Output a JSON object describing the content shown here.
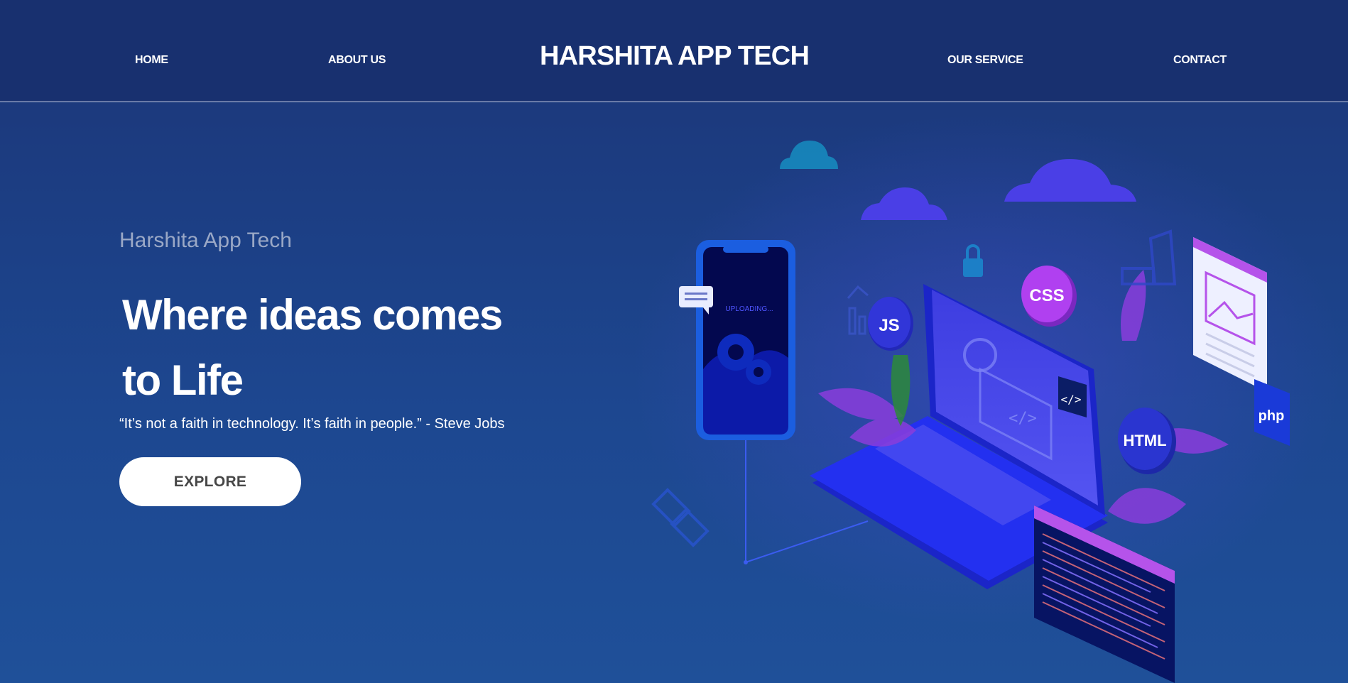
{
  "nav": {
    "home": "HOME",
    "about": "ABOUT US",
    "brand": "HARSHITA APP TECH",
    "service": "OUR SERVICE",
    "contact": "CONTACT"
  },
  "hero": {
    "subtitle": "Harshita App Tech",
    "title_line1": "Where ideas comes",
    "title_line2": "to Life",
    "quote": "“It’s not a faith in technology. It’s faith in people.” - Steve Jobs",
    "cta_label": "EXPLORE"
  },
  "illustration": {
    "phone_status": "UPLOADING...",
    "badge_js": "JS",
    "badge_css": "CSS",
    "badge_html": "HTML",
    "badge_php": "php",
    "code_tag": "</>"
  },
  "colors": {
    "nav_bg": "#18306f",
    "page_bg_top": "#1b3577",
    "page_bg_bottom": "#1f5099",
    "accent_purple": "#a93de0",
    "laptop_blue": "#2330f0",
    "cloud": "#4a3fe6",
    "button_bg": "#ffffff",
    "button_text": "#474747"
  }
}
